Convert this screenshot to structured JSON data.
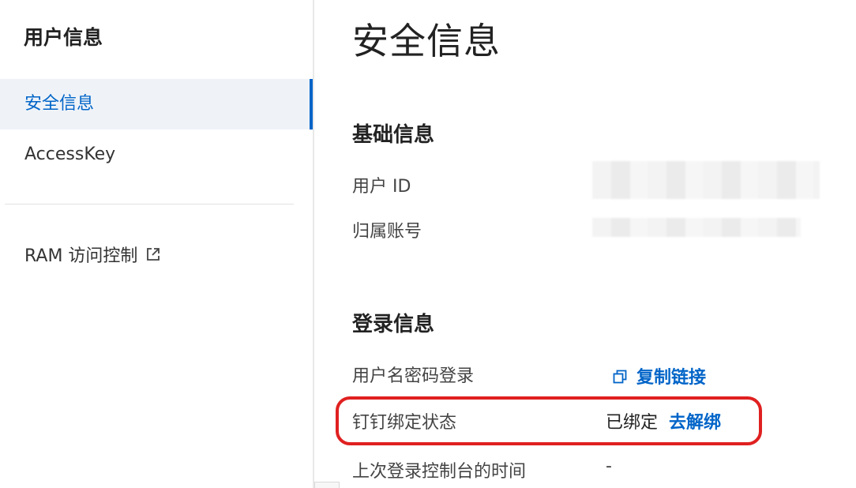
{
  "sidebar": {
    "title": "用户信息",
    "items": [
      {
        "label": "安全信息",
        "active": true
      },
      {
        "label": "AccessKey",
        "active": false
      }
    ],
    "external_link": {
      "label": "RAM 访问控制",
      "icon": "external-link-icon"
    }
  },
  "main": {
    "title": "安全信息",
    "basic_section": {
      "title": "基础信息",
      "rows": [
        {
          "label": "用户 ID"
        },
        {
          "label": "归属账号"
        }
      ]
    },
    "login_section": {
      "title": "登录信息",
      "rows": [
        {
          "label": "用户名密码登录",
          "action": "复制链接",
          "action_icon": "copy-icon"
        },
        {
          "label": "钉钉绑定状态",
          "value": "已绑定",
          "action": "去解绑"
        },
        {
          "label": "上次登录控制台的时间",
          "value": "-"
        }
      ]
    }
  },
  "colors": {
    "accent": "#0064c8",
    "active_bg": "#eff3f8",
    "highlight": "#e02020"
  }
}
